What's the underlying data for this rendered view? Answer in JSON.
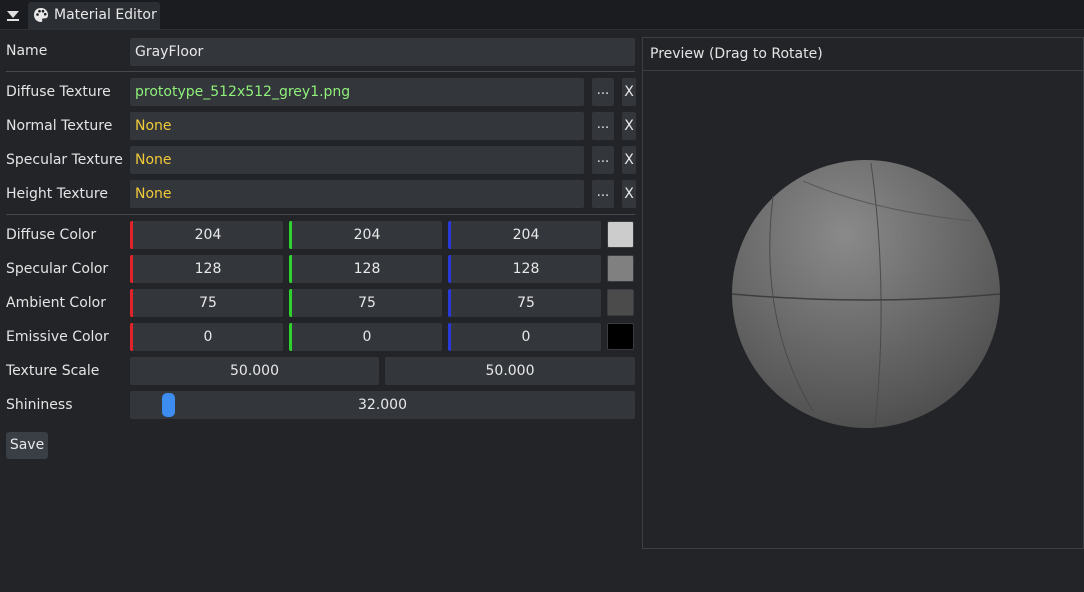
{
  "window": {
    "tab_title": "Material Editor",
    "tab_icon": "palette-icon",
    "collapse_icon": "collapse-arrow-icon"
  },
  "name_row": {
    "label": "Name",
    "value": "GrayFloor"
  },
  "textures": [
    {
      "label": "Diffuse Texture",
      "value": "prototype_512x512_grey1.png",
      "state": "assigned",
      "browse": "...",
      "clear": "X"
    },
    {
      "label": "Normal Texture",
      "value": "None",
      "state": "none",
      "browse": "...",
      "clear": "X"
    },
    {
      "label": "Specular Texture",
      "value": "None",
      "state": "none",
      "browse": "...",
      "clear": "X"
    },
    {
      "label": "Height Texture",
      "value": "None",
      "state": "none",
      "browse": "...",
      "clear": "X"
    }
  ],
  "colors": [
    {
      "label": "Diffuse Color",
      "r": "204",
      "g": "204",
      "b": "204",
      "swatch": "#cccccc"
    },
    {
      "label": "Specular Color",
      "r": "128",
      "g": "128",
      "b": "128",
      "swatch": "#808080"
    },
    {
      "label": "Ambient Color",
      "r": "75",
      "g": "75",
      "b": "75",
      "swatch": "#4b4b4b"
    },
    {
      "label": "Emissive Color",
      "r": "0",
      "g": "0",
      "b": "0",
      "swatch": "#000000"
    }
  ],
  "texture_scale": {
    "label": "Texture Scale",
    "u": "50.000",
    "v": "50.000"
  },
  "shininess": {
    "label": "Shininess",
    "value": "32.000",
    "level": 0.03
  },
  "save_label": "Save",
  "preview": {
    "title": "Preview (Drag to Rotate)",
    "object": "sphere"
  },
  "accent_colors": {
    "red": "#e0242a",
    "green": "#2fd12f",
    "blue": "#2a3ad8",
    "slider": "#3d8cf0"
  }
}
